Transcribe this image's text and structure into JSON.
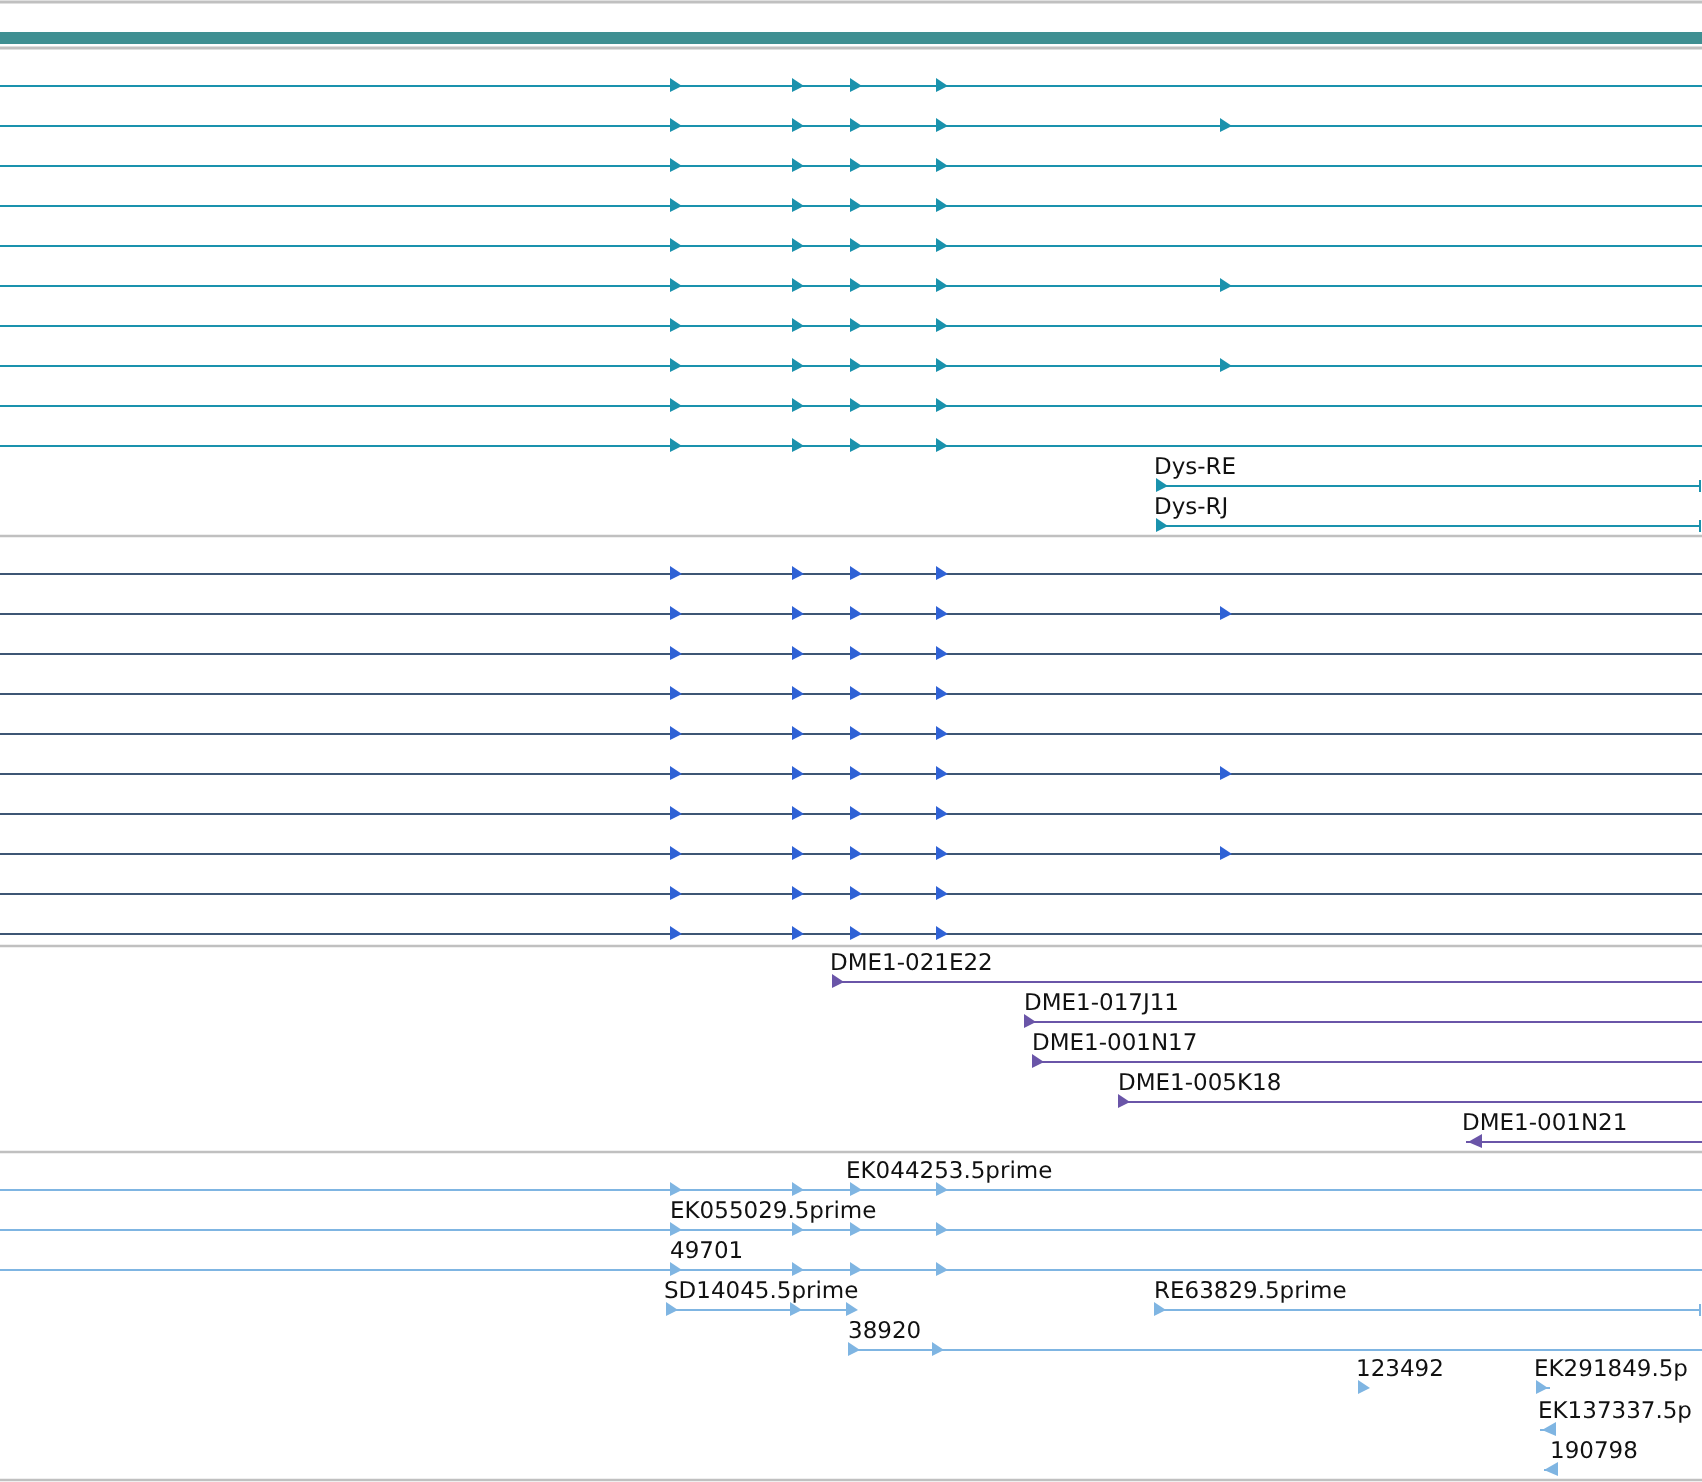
{
  "tracks": [
    {
      "color": "#1a92ad",
      "features": [
        {
          "reverse": false
        },
        {
          "reverse": false
        },
        {
          "reverse": false
        },
        {
          "reverse": false
        },
        {
          "reverse": false
        },
        {
          "reverse": false
        },
        {
          "reverse": false
        },
        {
          "reverse": false
        },
        {
          "reverse": false
        },
        {
          "reverse": false
        },
        {
          "label": "Dys-RE",
          "reverse": false
        },
        {
          "label": "Dys-RJ",
          "reverse": false
        }
      ]
    },
    {
      "color": "#2f62d6",
      "features": [
        {
          "reverse": false
        },
        {
          "reverse": false
        },
        {
          "reverse": false
        },
        {
          "reverse": false
        },
        {
          "reverse": false
        },
        {
          "reverse": false
        },
        {
          "reverse": false
        },
        {
          "reverse": false
        },
        {
          "reverse": false
        },
        {
          "reverse": false
        }
      ]
    },
    {
      "color": "#6a55a8",
      "features": [
        {
          "label": "DME1-021E22",
          "reverse": false
        },
        {
          "label": "DME1-017J11",
          "reverse": false
        },
        {
          "label": "DME1-001N17",
          "reverse": false
        },
        {
          "label": "DME1-005K18",
          "reverse": false
        },
        {
          "label": "DME1-001N21",
          "reverse": true
        }
      ]
    },
    {
      "color": "#7fb5e2",
      "features": [
        {
          "label": "EK044253.5prime",
          "reverse": false
        },
        {
          "label": "EK055029.5prime",
          "reverse": false
        },
        {
          "label": "49701",
          "reverse": false
        },
        {
          "label": "SD14045.5prime",
          "reverse": false
        },
        {
          "label": "RE63829.5prime",
          "reverse": false
        },
        {
          "label": "38920",
          "reverse": false
        },
        {
          "label": "123492",
          "reverse": false
        },
        {
          "label": "EK291849.5p",
          "reverse": false
        },
        {
          "label": "EK137337.5p",
          "reverse": true
        },
        {
          "label": "190798",
          "reverse": true
        }
      ]
    }
  ]
}
